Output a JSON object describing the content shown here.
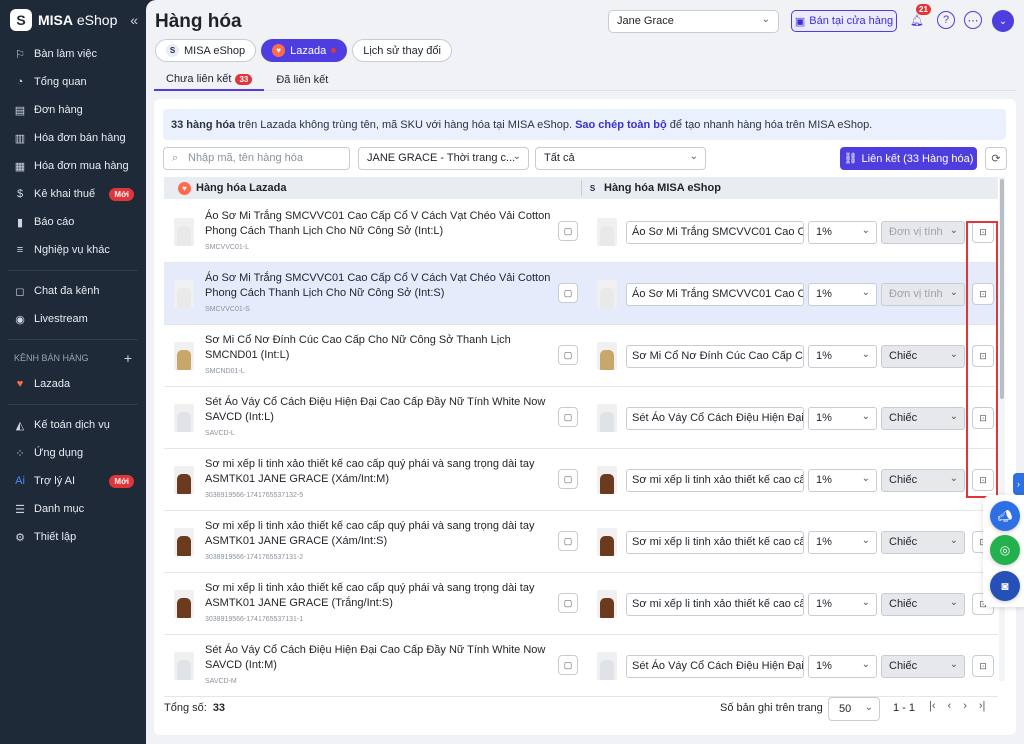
{
  "app": {
    "logo_mark": "S",
    "logo_brand": "MISA",
    "logo_product": " eShop",
    "collapse": "«"
  },
  "sidebar": {
    "items": [
      {
        "label": "Bàn làm việc",
        "icon": "⚐"
      },
      {
        "label": "Tổng quan",
        "icon": "◔"
      },
      {
        "label": "Đơn hàng",
        "icon": "▤"
      },
      {
        "label": "Hóa đơn bán hàng",
        "icon": "▥"
      },
      {
        "label": "Hóa đơn mua hàng",
        "icon": "▦"
      },
      {
        "label": "Kê khai thuế",
        "icon": "$",
        "badge": "Mới"
      },
      {
        "label": "Báo cáo",
        "icon": "▮"
      },
      {
        "label": "Nghiệp vụ khác",
        "icon": "≡"
      }
    ],
    "items2": [
      {
        "label": "Chat đa kênh",
        "icon": "◻"
      },
      {
        "label": "Livestream",
        "icon": "◉"
      }
    ],
    "section_label": "KÊNH BÁN HÀNG",
    "section_plus": "+",
    "channel": {
      "label": "Lazada",
      "icon": "♥"
    },
    "items3": [
      {
        "label": "Kế toán dịch vụ",
        "icon": "◭"
      },
      {
        "label": "Ứng dụng",
        "icon": "⁘"
      },
      {
        "label": "Trợ lý AI",
        "icon": "Ai",
        "badge": "Mới"
      },
      {
        "label": "Danh mục",
        "icon": "☰"
      },
      {
        "label": "Thiết lập",
        "icon": "⚙"
      }
    ]
  },
  "header": {
    "title": "Hàng hóa",
    "user": "Jane Grace",
    "store_button": "Bán tại cửa hàng",
    "bell_count": "21",
    "help": "?",
    "more": "⋯",
    "avatar": "⌄"
  },
  "channel_tabs": [
    {
      "label": "MISA eShop"
    },
    {
      "label": "Lazada"
    },
    {
      "label": "Lịch sử thay đổi"
    }
  ],
  "sub_tabs": {
    "unlinked": "Chưa liên kết",
    "unlinked_count": "33",
    "linked": "Đã liên kết"
  },
  "info": {
    "bold": "33 hàng hóa",
    "text1": " trên Lazada không trùng tên, mã SKU với hàng hóa tại MISA eShop. ",
    "link": "Sao chép toàn bộ",
    "text2": " để tạo nhanh hàng hóa trên MISA eShop."
  },
  "filters": {
    "search_placeholder": "Nhập mã, tên hàng hóa",
    "shop": "JANE GRACE - Thời trang c...",
    "status": "Tất cả",
    "link_button": "Liên kết (33 Hàng hóa)"
  },
  "table": {
    "col_lazada": "Hàng hóa Lazada",
    "col_misa": "Hàng hóa MISA eShop",
    "rows": [
      {
        "name": "Áo Sơ Mi Trắng SMCVVC01 Cao Cấp Cổ V Cách Vạt Chéo Vải Cotton Phong Cách Thanh Lịch Cho Nữ Công Sở (Int:L)",
        "sku": "SMCVVC01-L",
        "misa_name": "Áo Sơ Mi Trắng SMCVVC01 Cao Cấp C",
        "pct": "1%",
        "unit": "Đơn vị tính",
        "unit_disabled": true,
        "color": "#e9e9e9"
      },
      {
        "name": "Áo Sơ Mi Trắng SMCVVC01 Cao Cấp Cổ V Cách Vạt Chéo Vải Cotton Phong Cách Thanh Lịch Cho Nữ Công Sở (Int:S)",
        "sku": "SMCVVC01-S",
        "misa_name": "Áo Sơ Mi Trắng SMCVVC01 Cao Cấp C",
        "pct": "1%",
        "unit": "Đơn vị tính",
        "unit_disabled": true,
        "color": "#e9e9e9",
        "selected": true
      },
      {
        "name": "Sơ Mi Cổ Nơ Đính Cúc Cao Cấp Cho Nữ Công Sở Thanh Lịch SMCND01 (Int:L)",
        "sku": "SMCND01-L",
        "misa_name": "Sơ Mi Cổ Nơ Đính Cúc Cao Cấp Cho N",
        "pct": "1%",
        "unit": "Chiếc",
        "color": "#c8a76a"
      },
      {
        "name": "Sét Áo Váy Cổ Cách Điệu Hiện Đại Cao Cấp Đầy Nữ Tính White Now SAVCD (Int:L)",
        "sku": "SAVCD-L",
        "misa_name": "Sét Áo Váy Cổ Cách Điệu Hiện Đại Cao",
        "pct": "1%",
        "unit": "Chiếc",
        "color": "#dfe3e8"
      },
      {
        "name": "Sơ mi xếp li tinh xảo thiết kế cao cấp quý phái và sang trọng dài tay ASMTK01 JANE GRACE (Xám/Int:M)",
        "sku": "3038919566-1741765537132-5",
        "misa_name": "Sơ mi xếp li tinh xảo  thiết kế cao cấp c",
        "pct": "1%",
        "unit": "Chiếc",
        "color": "#6b3a1f"
      },
      {
        "name": "Sơ mi xếp li tinh xảo thiết kế cao cấp quý phái và sang trọng dài tay ASMTK01 JANE GRACE (Xám/Int:S)",
        "sku": "3038919566-1741765537131-2",
        "misa_name": "Sơ mi xếp li tinh xảo  thiết kế cao cấp c",
        "pct": "1%",
        "unit": "Chiếc",
        "color": "#6b3a1f"
      },
      {
        "name": "Sơ mi xếp li tinh xảo thiết kế cao cấp quý phái và sang trọng dài tay ASMTK01 JANE GRACE (Trắng/Int:S)",
        "sku": "3038919566-1741765537131-1",
        "misa_name": "Sơ mi xếp li tinh xảo  thiết kế cao cấp c",
        "pct": "1%",
        "unit": "Chiếc",
        "color": "#6b3a1f"
      },
      {
        "name": "Sét Áo Váy Cổ Cách Điệu Hiện Đại Cao Cấp Đầy Nữ Tính White Now SAVCD (Int:M)",
        "sku": "SAVCD-M",
        "misa_name": "Sét Áo Váy Cổ Cách Điệu Hiện Đại Cao",
        "pct": "1%",
        "unit": "Chiếc",
        "color": "#dfe3e8"
      }
    ]
  },
  "footer": {
    "total_label": "Tổng số:",
    "total": "33",
    "per_page_label": "Số bản ghi trên trang",
    "per_page": "50",
    "range": "1 - 1",
    "first": "|‹",
    "prev": "‹",
    "next": "›",
    "last": "›|"
  },
  "colors": {
    "accent": "#4e3ee0",
    "sidebar": "#1e2a38",
    "highlight": "#e0363a"
  }
}
